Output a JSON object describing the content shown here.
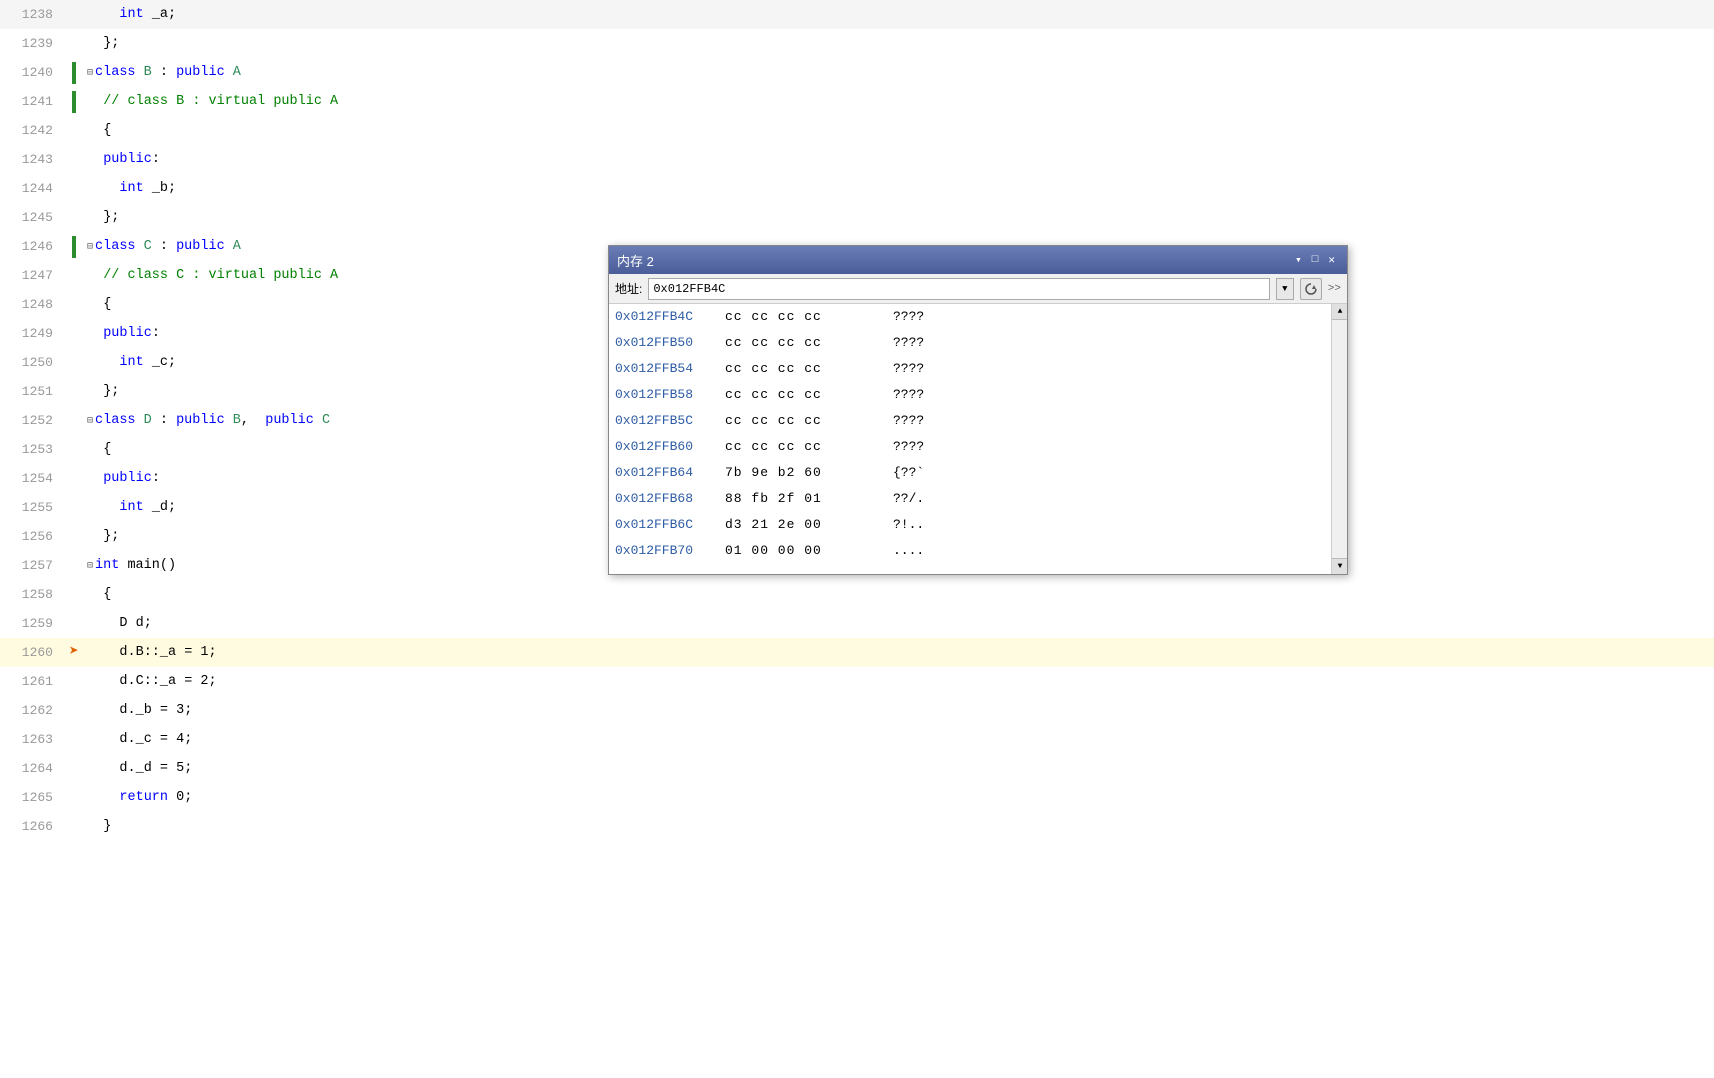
{
  "editor": {
    "background": "#ffffff",
    "lines": [
      {
        "num": "1238",
        "indent": 2,
        "marker": "",
        "content": [
          {
            "t": "    int _a;",
            "c": "plain"
          }
        ]
      },
      {
        "num": "1239",
        "indent": 1,
        "marker": "",
        "content": [
          {
            "t": "  };",
            "c": "plain"
          }
        ]
      },
      {
        "num": "1240",
        "indent": 0,
        "marker": "green",
        "content": [
          {
            "t": "class B : public A",
            "c": "mixed1"
          }
        ]
      },
      {
        "num": "1241",
        "indent": 0,
        "marker": "green",
        "content": [
          {
            "t": "  // class B : virtual public A",
            "c": "comment"
          }
        ]
      },
      {
        "num": "1242",
        "indent": 0,
        "marker": "",
        "content": [
          {
            "t": "  {",
            "c": "plain"
          }
        ]
      },
      {
        "num": "1243",
        "indent": 1,
        "marker": "",
        "content": [
          {
            "t": "  public:",
            "c": "keyword"
          }
        ]
      },
      {
        "num": "1244",
        "indent": 2,
        "marker": "",
        "content": [
          {
            "t": "    int _b;",
            "c": "mixed2"
          }
        ]
      },
      {
        "num": "1245",
        "indent": 1,
        "marker": "",
        "content": [
          {
            "t": "  };",
            "c": "plain"
          }
        ]
      },
      {
        "num": "1246",
        "indent": 0,
        "marker": "green",
        "content": [
          {
            "t": "class C : public A",
            "c": "mixed1"
          }
        ]
      },
      {
        "num": "1247",
        "indent": 0,
        "marker": "",
        "content": [
          {
            "t": "  // class C : virtual public A",
            "c": "comment"
          }
        ]
      },
      {
        "num": "1248",
        "indent": 0,
        "marker": "",
        "content": [
          {
            "t": "  {",
            "c": "plain"
          }
        ]
      },
      {
        "num": "1249",
        "indent": 1,
        "marker": "",
        "content": [
          {
            "t": "  public:",
            "c": "keyword"
          }
        ]
      },
      {
        "num": "1250",
        "indent": 2,
        "marker": "",
        "content": [
          {
            "t": "    int _c;",
            "c": "mixed2"
          }
        ]
      },
      {
        "num": "1251",
        "indent": 1,
        "marker": "",
        "content": [
          {
            "t": "  };",
            "c": "plain"
          }
        ]
      },
      {
        "num": "1252",
        "indent": 0,
        "marker": "collapse",
        "content": [
          {
            "t": "class D : public B,  public C",
            "c": "mixed3"
          }
        ]
      },
      {
        "num": "1253",
        "indent": 0,
        "marker": "",
        "content": [
          {
            "t": "  {",
            "c": "plain"
          }
        ]
      },
      {
        "num": "1254",
        "indent": 1,
        "marker": "",
        "content": [
          {
            "t": "  public:",
            "c": "keyword"
          }
        ]
      },
      {
        "num": "1255",
        "indent": 2,
        "marker": "",
        "content": [
          {
            "t": "    int _d;",
            "c": "mixed2"
          }
        ]
      },
      {
        "num": "1256",
        "indent": 1,
        "marker": "",
        "content": [
          {
            "t": "  };",
            "c": "plain"
          }
        ]
      },
      {
        "num": "1257",
        "indent": 0,
        "marker": "collapse",
        "content": [
          {
            "t": "int main()",
            "c": "mixed4"
          }
        ]
      },
      {
        "num": "1258",
        "indent": 0,
        "marker": "",
        "content": [
          {
            "t": "  {",
            "c": "plain"
          }
        ]
      },
      {
        "num": "1259",
        "indent": 1,
        "marker": "",
        "content": [
          {
            "t": "    D d;",
            "c": "plain"
          }
        ]
      },
      {
        "num": "1260",
        "indent": 1,
        "marker": "arrow",
        "content": [
          {
            "t": "    d.B::_a = 1;",
            "c": "plain"
          }
        ]
      },
      {
        "num": "1261",
        "indent": 1,
        "marker": "",
        "content": [
          {
            "t": "    d.C::_a = 2;",
            "c": "plain"
          }
        ]
      },
      {
        "num": "1262",
        "indent": 1,
        "marker": "",
        "content": [
          {
            "t": "    d._b = 3;",
            "c": "plain"
          }
        ]
      },
      {
        "num": "1263",
        "indent": 1,
        "marker": "",
        "content": [
          {
            "t": "    d._c = 4;",
            "c": "plain"
          }
        ]
      },
      {
        "num": "1264",
        "indent": 1,
        "marker": "",
        "content": [
          {
            "t": "    d._d = 5;",
            "c": "plain"
          }
        ]
      },
      {
        "num": "1265",
        "indent": 1,
        "marker": "",
        "content": [
          {
            "t": "    return 0;",
            "c": "mixed5"
          }
        ]
      },
      {
        "num": "1266",
        "indent": 0,
        "marker": "",
        "content": [
          {
            "t": "  }",
            "c": "plain"
          }
        ]
      }
    ]
  },
  "memory_window": {
    "title": "内存 2",
    "addr_label": "地址:",
    "addr_value": "0x012FFB4C",
    "rows": [
      {
        "addr": "0x012FFB4C",
        "bytes": "cc  cc  cc  cc",
        "chars": "????"
      },
      {
        "addr": "0x012FFB50",
        "bytes": "cc  cc  cc  cc",
        "chars": "????"
      },
      {
        "addr": "0x012FFB54",
        "bytes": "cc  cc  cc  cc",
        "chars": "????"
      },
      {
        "addr": "0x012FFB58",
        "bytes": "cc  cc  cc  cc",
        "chars": "????"
      },
      {
        "addr": "0x012FFB5C",
        "bytes": "cc  cc  cc  cc",
        "chars": "????"
      },
      {
        "addr": "0x012FFB60",
        "bytes": "cc  cc  cc  cc",
        "chars": "????"
      },
      {
        "addr": "0x012FFB64",
        "bytes": "7b  9e  b2  60",
        "chars": "{??`"
      },
      {
        "addr": "0x012FFB68",
        "bytes": "88  fb  2f  01",
        "chars": "??/."
      },
      {
        "addr": "0x012FFB6C",
        "bytes": "d3  21  2e  00",
        "chars": "?!.."
      },
      {
        "addr": "0x012FFB70",
        "bytes": "01  00  00  00",
        "chars": "...."
      }
    ]
  }
}
